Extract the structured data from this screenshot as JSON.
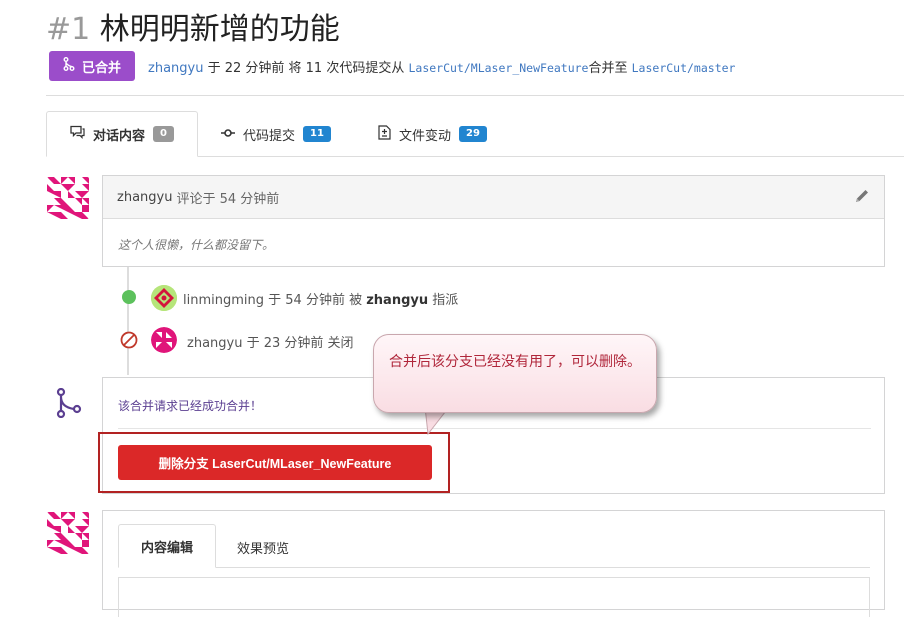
{
  "pr": {
    "number": "#1",
    "title": "林明明新增的功能",
    "status_label": "已合并",
    "author": "zhangyu",
    "meta_part1": " 于 22 分钟前 将 11 次代码提交从 ",
    "source_branch": "LaserCut/MLaser_NewFeature",
    "meta_part2": "合并至 ",
    "target_branch": "LaserCut/master"
  },
  "tabs": [
    {
      "label": "对话内容",
      "count": "0",
      "icon": "comment-icon"
    },
    {
      "label": "代码提交",
      "count": "11",
      "icon": "commit-icon"
    },
    {
      "label": "文件变动",
      "count": "29",
      "icon": "file-diff-icon"
    }
  ],
  "comment": {
    "author": "zhangyu",
    "time": "评论于 54 分钟前",
    "body": "这个人很懒，什么都没留下。",
    "edit_icon": "pencil-icon"
  },
  "events": [
    {
      "actor": "linmingming",
      "text1": " 于 54 分钟前 被 ",
      "assigner": "zhangyu",
      "text2": " 指派"
    },
    {
      "actor": "zhangyu",
      "text1": " 于 23 分钟前 关闭",
      "assigner": "",
      "text2": ""
    }
  ],
  "merge": {
    "message": "该合并请求已经成功合并！",
    "delete_button": "删除分支 LaserCut/MLaser_NewFeature",
    "icon": "merge-icon"
  },
  "callout": {
    "text": "合并后该分支已经没有用了，可以删除。"
  },
  "editor": {
    "tab_edit": "内容编辑",
    "tab_preview": "效果预览"
  },
  "colors": {
    "merged_purple": "#9b4dca",
    "link_blue": "#4078c0",
    "count_blue": "#2185d0",
    "delete_red": "#db2828",
    "open_green": "#5cc15c",
    "closed_red": "#c0392b"
  }
}
